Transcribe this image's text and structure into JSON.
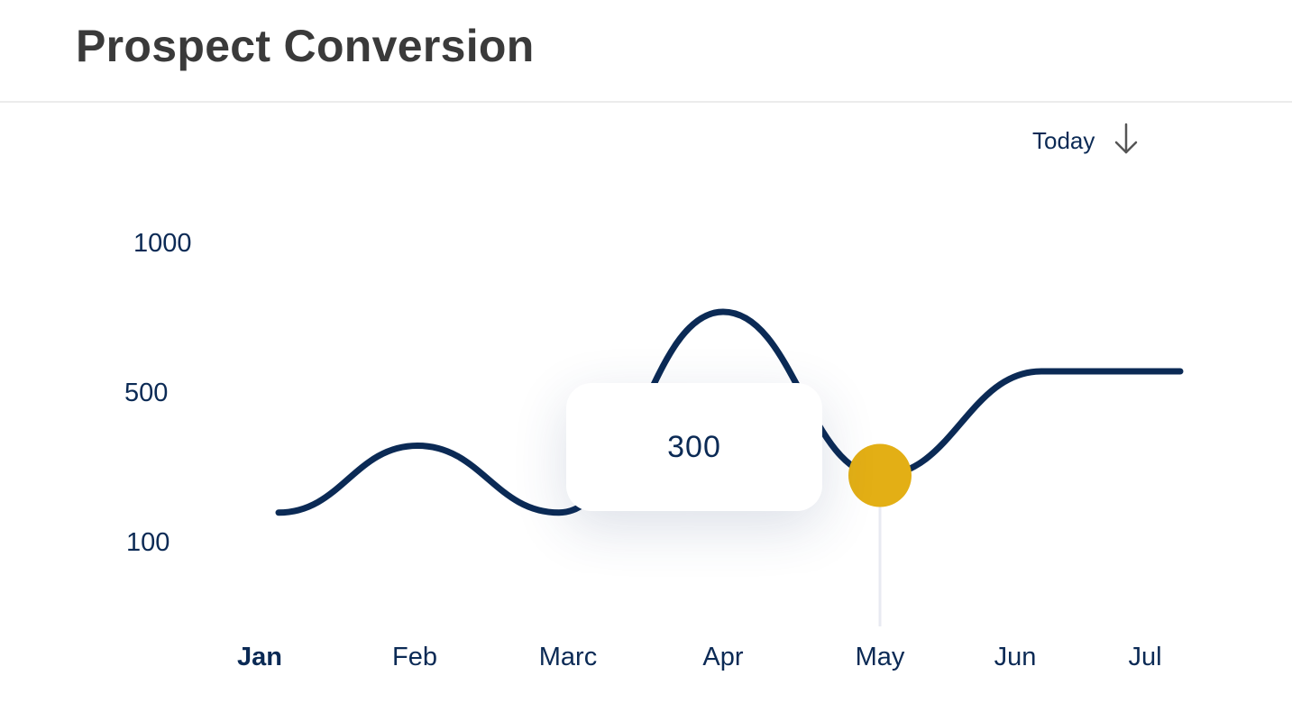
{
  "header": {
    "title": "Prospect Conversion"
  },
  "range": {
    "label": "Today",
    "icon": "arrow-down-icon"
  },
  "tooltip": {
    "value": "300"
  },
  "colors": {
    "line": "#0b2a55",
    "highlight": "#e3af15",
    "text": "#0b2a55"
  },
  "chart_data": {
    "type": "line",
    "title": "",
    "xlabel": "",
    "ylabel": "",
    "categories": [
      "Jan",
      "Feb",
      "Marc",
      "Apr",
      "May",
      "Jun",
      "Jul"
    ],
    "y_ticks": [
      "1000",
      "500",
      "100"
    ],
    "series": [
      {
        "values": [
          200,
          380,
          200,
          800,
          300,
          600,
          600
        ]
      }
    ],
    "highlight": {
      "category": "May",
      "value": 300
    },
    "active_category": "Jan",
    "grid": false
  }
}
